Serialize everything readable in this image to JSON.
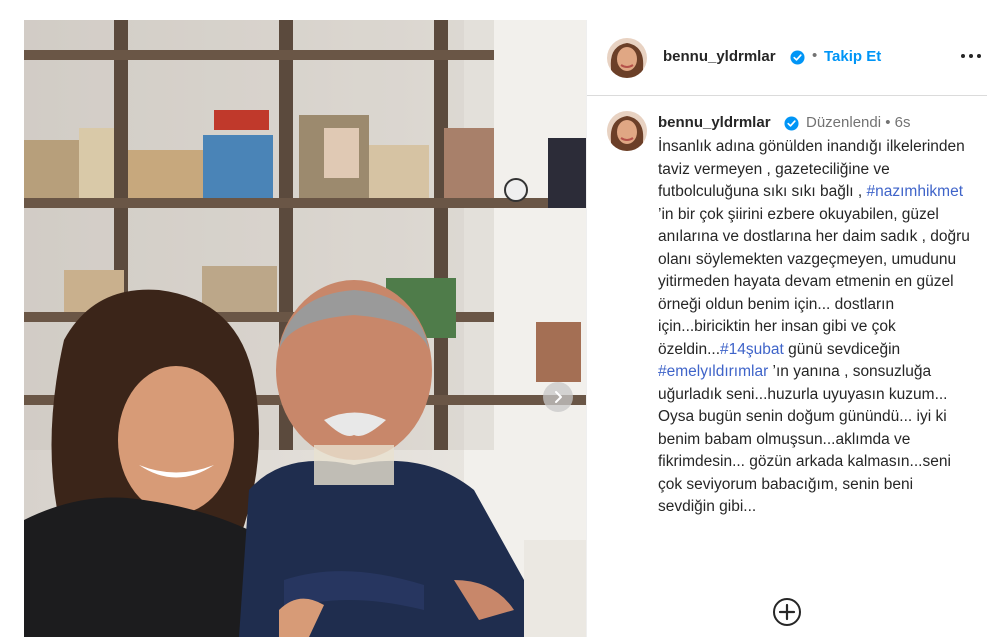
{
  "post": {
    "username": "bennu_yldrmlar",
    "follow_label": "Takip Et",
    "separator": "•"
  },
  "caption": {
    "username": "bennu_yldrmlar",
    "meta": "Düzenlendi •  6s",
    "segments": [
      {
        "text": "İnsanlık adına gönülden inandığı ilkelerinden taviz vermeyen , gazeteciliğine ve futbolculuğuna sıkı sıkı bağlı , ",
        "tag": false
      },
      {
        "text": "#nazımhikmet",
        "tag": true
      },
      {
        "text": " ’in bir çok şiirini ezbere okuyabilen, güzel anılarına ve dostlarına her daim sadık , doğru olanı söylemekten vazgeçmeyen, umudunu yitirmeden hayata devam etmenin en güzel örneği oldun benim için... dostların için...biriciktin her insan gibi ve çok özeldin...",
        "tag": false
      },
      {
        "text": "#14şubat",
        "tag": true
      },
      {
        "text": " günü sevdiceğin ",
        "tag": false
      },
      {
        "text": "#emelyıldırımlar",
        "tag": true
      },
      {
        "text": " ’ın yanına , sonsuzluğa uğurladık seni...huzurla uyuyasın kuzum...\nOysa bugün senin doğum günündü... iyi ki benim babam olmuşsun...aklımda ve fikrimdesin... gözün arkada kalmasın...seni çok seviyorum babacığım, senin beni sevdiğin gibi...",
        "tag": false
      }
    ]
  },
  "icons": {
    "verified": "verified-badge-icon",
    "more": "more-options-icon",
    "next": "chevron-right-icon",
    "add": "add-circle-icon"
  },
  "colors": {
    "follow": "#0095f6",
    "verified": "#0095f6",
    "hashtag": "#3f64c9",
    "muted": "#737373"
  }
}
